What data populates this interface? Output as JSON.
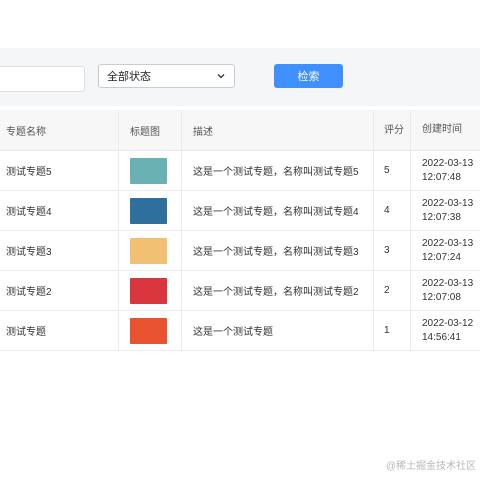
{
  "filters": {
    "search_value": "",
    "status_selected": "全部状态",
    "search_button": "检索"
  },
  "table": {
    "headers": {
      "name": "专题名称",
      "thumb": "标题图",
      "desc": "描述",
      "score": "评分",
      "time": "创建时间"
    },
    "rows": [
      {
        "name": "测试专题5",
        "desc": "这是一个测试专题，名称叫测试专题5",
        "score": "5",
        "date": "2022-03-13",
        "clock": "12:07:48",
        "thumb_color": "#6ab1b3"
      },
      {
        "name": "测试专题4",
        "desc": "这是一个测试专题，名称叫测试专题4",
        "score": "4",
        "date": "2022-03-13",
        "clock": "12:07:38",
        "thumb_color": "#2f6f9e"
      },
      {
        "name": "测试专题3",
        "desc": "这是一个测试专题，名称叫测试专题3",
        "score": "3",
        "date": "2022-03-13",
        "clock": "12:07:24",
        "thumb_color": "#f1c073"
      },
      {
        "name": "测试专题2",
        "desc": "这是一个测试专题，名称叫测试专题2",
        "score": "2",
        "date": "2022-03-13",
        "clock": "12:07:08",
        "thumb_color": "#d9363e"
      },
      {
        "name": "测试专题",
        "desc": "这是一个测试专题",
        "score": "1",
        "date": "2022-03-12",
        "clock": "14:56:41",
        "thumb_color": "#e8522e"
      }
    ]
  },
  "watermark": "@稀土掘金技术社区"
}
